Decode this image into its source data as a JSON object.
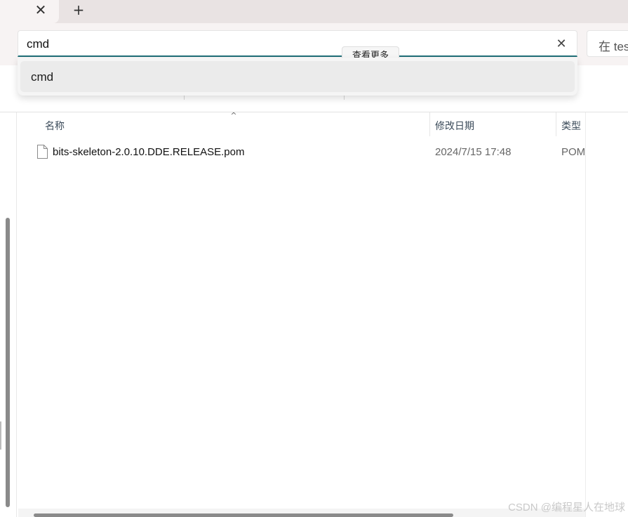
{
  "tabs": {
    "close_glyph": "✕",
    "new_tab_glyph": "+"
  },
  "address_bar": {
    "value": "cmd",
    "clear_glyph": "✕"
  },
  "search_box": {
    "placeholder": "在 tes"
  },
  "hidden_tooltip": "查看更多",
  "suggestions": [
    {
      "label": "cmd"
    }
  ],
  "file_list": {
    "columns": {
      "name": "名称",
      "modified": "修改日期",
      "type": "类型"
    },
    "sort_glyph": "^",
    "rows": [
      {
        "name": "bits-skeleton-2.0.10.DDE.RELEASE.pom",
        "modified": "2024/7/15 17:48",
        "type": "POM"
      }
    ]
  },
  "watermark": "CSDN @编程星人在地球",
  "colors": {
    "accent_underline": "#1f6f78",
    "tabstrip_bg": "#e9e3e3",
    "toolbar_bg": "#f7f3f3"
  }
}
